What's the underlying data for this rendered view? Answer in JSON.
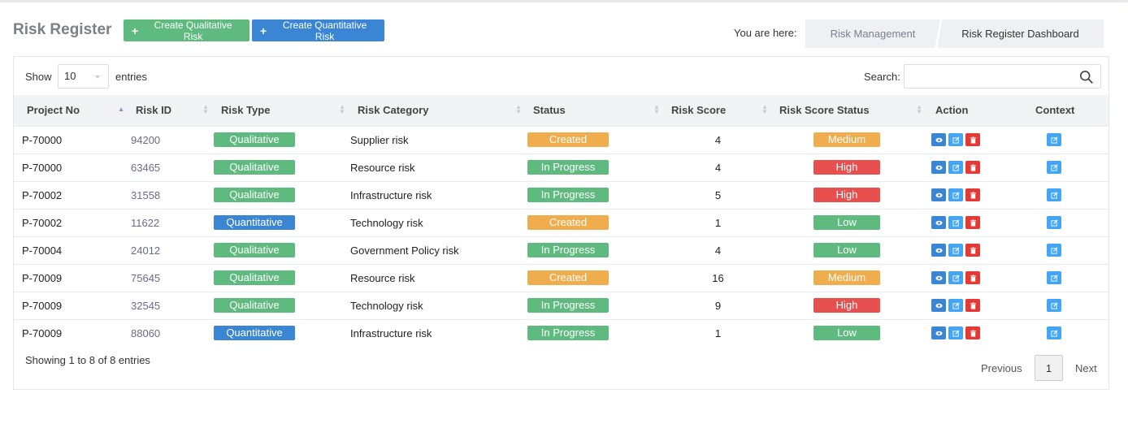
{
  "header": {
    "title": "Risk Register",
    "create_qualitative": "Create Qualitative Risk",
    "create_quantitative": "Create Quantitative Risk",
    "breadcrumb_label": "You are here:",
    "breadcrumb": [
      "Risk Management",
      "Risk Register Dashboard"
    ]
  },
  "controls": {
    "show_label": "Show",
    "length_value": "10",
    "entries_label": "entries",
    "search_label": "Search:",
    "search_value": ""
  },
  "table": {
    "columns": [
      "Project No",
      "Risk ID",
      "Risk Type",
      "Risk Category",
      "Status",
      "Risk Score",
      "Risk Score Status",
      "Action",
      "Context"
    ],
    "rows": [
      {
        "project": "P-70000",
        "risk_id": "94200",
        "type": "Qualitative",
        "category": "Supplier risk",
        "status": "Created",
        "score": "4",
        "score_status": "Medium"
      },
      {
        "project": "P-70000",
        "risk_id": "63465",
        "type": "Qualitative",
        "category": "Resource risk",
        "status": "In Progress",
        "score": "4",
        "score_status": "High"
      },
      {
        "project": "P-70002",
        "risk_id": "31558",
        "type": "Qualitative",
        "category": "Infrastructure risk",
        "status": "In Progress",
        "score": "5",
        "score_status": "High"
      },
      {
        "project": "P-70002",
        "risk_id": "11622",
        "type": "Quantitative",
        "category": "Technology risk",
        "status": "Created",
        "score": "1",
        "score_status": "Low"
      },
      {
        "project": "P-70004",
        "risk_id": "24012",
        "type": "Qualitative",
        "category": "Government Policy risk",
        "status": "In Progress",
        "score": "4",
        "score_status": "Low"
      },
      {
        "project": "P-70009",
        "risk_id": "75645",
        "type": "Qualitative",
        "category": "Resource risk",
        "status": "Created",
        "score": "16",
        "score_status": "Medium"
      },
      {
        "project": "P-70009",
        "risk_id": "32545",
        "type": "Qualitative",
        "category": "Technology risk",
        "status": "In Progress",
        "score": "9",
        "score_status": "High"
      },
      {
        "project": "P-70009",
        "risk_id": "88060",
        "type": "Quantitative",
        "category": "Infrastructure risk",
        "status": "In Progress",
        "score": "1",
        "score_status": "Low"
      }
    ]
  },
  "footer": {
    "info": "Showing 1 to 8 of 8 entries",
    "previous": "Previous",
    "page": "1",
    "next": "Next"
  },
  "colors": {
    "qualitative": "#5fba80",
    "quantitative": "#3a86d4",
    "created": "#f0ad4e",
    "in_progress": "#5fba80",
    "high": "#e85050",
    "medium": "#f0ad4e",
    "low": "#5fba80",
    "view": "#3a86d4",
    "edit": "#42a5f5",
    "delete": "#e53935"
  }
}
